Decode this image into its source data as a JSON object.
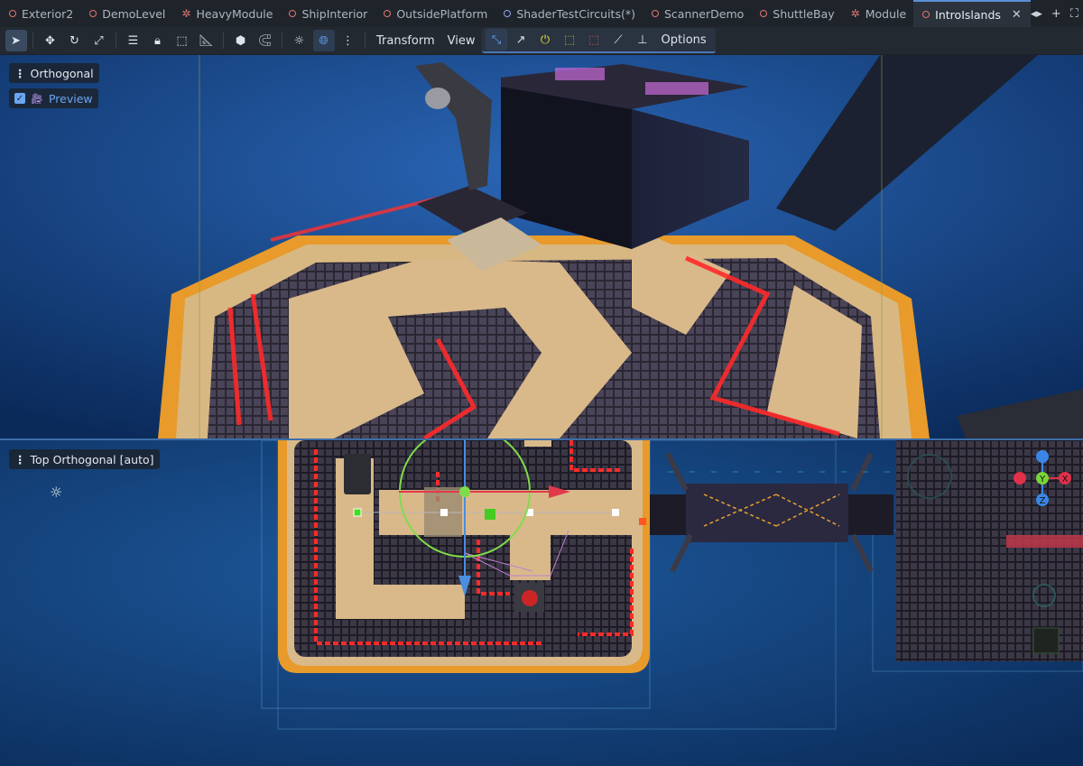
{
  "tabs": [
    {
      "label": "Exterior2",
      "icon": "scene-icon"
    },
    {
      "label": "DemoLevel",
      "icon": "scene-icon"
    },
    {
      "label": "HeavyModule",
      "icon": "node-icon"
    },
    {
      "label": "ShipInterior",
      "icon": "scene-icon"
    },
    {
      "label": "OutsidePlatform",
      "icon": "scene-icon"
    },
    {
      "label": "ShaderTestCircuits(*)",
      "icon": "scene-icon-blue"
    },
    {
      "label": "ScannerDemo",
      "icon": "scene-icon"
    },
    {
      "label": "ShuttleBay",
      "icon": "scene-icon"
    },
    {
      "label": "Module",
      "icon": "node-icon"
    },
    {
      "label": "IntroIslands",
      "icon": "scene-icon",
      "active": true
    }
  ],
  "toolbar": {
    "transform_label": "Transform",
    "view_label": "View",
    "options_label": "Options"
  },
  "viewport_top": {
    "menu_label": "Orthogonal",
    "preview_label": "Preview",
    "preview_checked": true
  },
  "viewport_bottom": {
    "menu_label": "Top Orthogonal [auto]"
  },
  "gizmo": {
    "x_label": "X",
    "y_label": "Y",
    "z_label": "Z",
    "x_color": "#e0304a",
    "y_color": "#7ad43a",
    "z_color": "#3a86e8"
  },
  "colors": {
    "accent": "#5b8fd9",
    "sky": "#0f3d7a",
    "sand": "#d9b98a",
    "neon_red": "#ff2a2a",
    "tile": "#3b3745",
    "selection_ring": "#7fdc4a"
  }
}
